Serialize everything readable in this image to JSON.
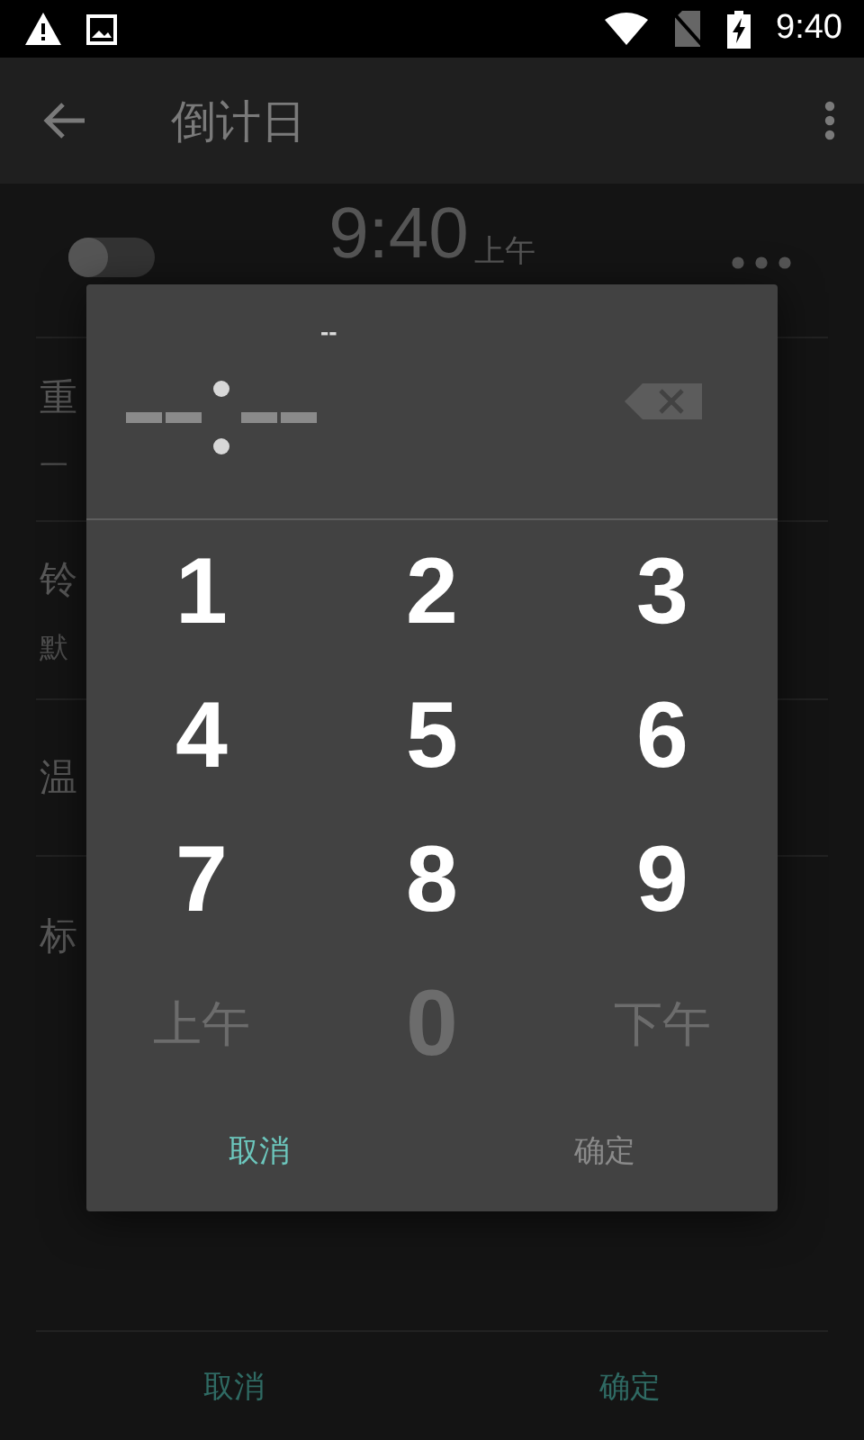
{
  "status_bar": {
    "time": "9:40"
  },
  "app_bar": {
    "title": "倒计日"
  },
  "alarm": {
    "time": "9:40",
    "period": "上午",
    "enabled": false
  },
  "settings": [
    {
      "label": "重",
      "sub": "一"
    },
    {
      "label": "铃",
      "sub": "默"
    },
    {
      "label": "温"
    },
    {
      "label": "标"
    }
  ],
  "bottom_buttons": [
    {
      "label": "取消"
    },
    {
      "label": "确定"
    }
  ],
  "dialog": {
    "period_display": "--",
    "keys": [
      {
        "label": "1",
        "disabled": false
      },
      {
        "label": "2",
        "disabled": false
      },
      {
        "label": "3",
        "disabled": false
      },
      {
        "label": "4",
        "disabled": false
      },
      {
        "label": "5",
        "disabled": false
      },
      {
        "label": "6",
        "disabled": false
      },
      {
        "label": "7",
        "disabled": false
      },
      {
        "label": "8",
        "disabled": false
      },
      {
        "label": "9",
        "disabled": false
      },
      {
        "label": "上午",
        "disabled": true
      },
      {
        "label": "0",
        "disabled": true
      },
      {
        "label": "下午",
        "disabled": true
      }
    ],
    "buttons": [
      {
        "label": "取消",
        "disabled": false
      },
      {
        "label": "确定",
        "disabled": true
      }
    ]
  }
}
